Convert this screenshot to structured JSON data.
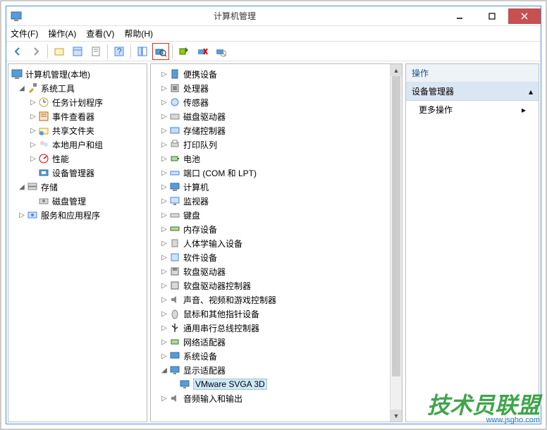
{
  "window": {
    "title": "计算机管理"
  },
  "menubar": {
    "file": "文件(F)",
    "action": "操作(A)",
    "view": "查看(V)",
    "help": "帮助(H)"
  },
  "left_tree": {
    "root": "计算机管理(本地)",
    "sys_tools": "系统工具",
    "task_sched": "任务计划程序",
    "event_viewer": "事件查看器",
    "shared": "共享文件夹",
    "local_users": "本地用户和组",
    "perf": "性能",
    "dev_mgr": "设备管理器",
    "storage": "存储",
    "disk_mgmt": "磁盘管理",
    "services": "服务和应用程序"
  },
  "devices": {
    "root_icon": "computer",
    "portable": "便携设备",
    "cpu": "处理器",
    "sensor": "传感器",
    "disk": "磁盘驱动器",
    "storage_ctrl": "存储控制器",
    "print_queue": "打印队列",
    "battery": "电池",
    "ports": "端口 (COM 和 LPT)",
    "computer": "计算机",
    "monitor": "监视器",
    "keyboard": "键盘",
    "memory": "内存设备",
    "hid": "人体学输入设备",
    "soft_dev": "软件设备",
    "floppy": "软盘驱动器",
    "floppy_ctrl": "软盘驱动器控制器",
    "sound": "声音、视频和游戏控制器",
    "mouse": "鼠标和其他指针设备",
    "usb": "通用串行总线控制器",
    "net": "网络适配器",
    "sys_dev": "系统设备",
    "display": "显示适配器",
    "display_child": "VMware SVGA 3D",
    "audio": "音频输入和输出"
  },
  "actions": {
    "header": "操作",
    "section": "设备管理器",
    "more": "更多操作"
  },
  "watermark": {
    "line1": "技术员联盟",
    "line2": "www.jsgho.com"
  }
}
